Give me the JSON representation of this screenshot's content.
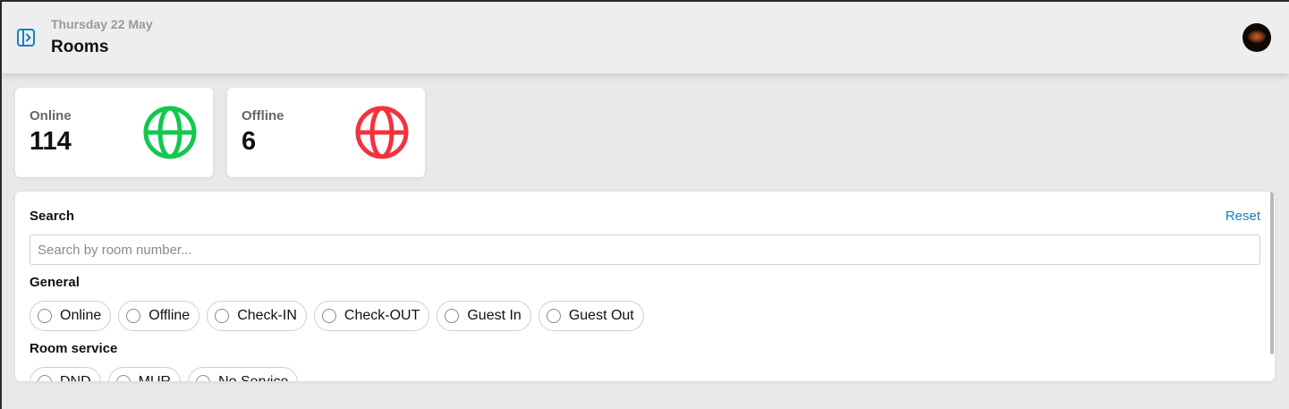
{
  "header": {
    "date": "Thursday 22 May",
    "title": "Rooms",
    "sidebar_toggle_icon": "sidebar-toggle-icon",
    "avatar_icon": "user-avatar"
  },
  "stats": {
    "online": {
      "label": "Online",
      "value": "114",
      "icon": "globe-icon",
      "color": "#12c84f"
    },
    "offline": {
      "label": "Offline",
      "value": "6",
      "icon": "globe-icon",
      "color": "#f2333d"
    }
  },
  "filters": {
    "search_title": "Search",
    "reset_label": "Reset",
    "search_placeholder": "Search by room number...",
    "search_value": "",
    "general_title": "General",
    "general_options": [
      "Online",
      "Offline",
      "Check-IN",
      "Check-OUT",
      "Guest In",
      "Guest Out"
    ],
    "room_service_title": "Room service",
    "room_service_options": [
      "DND",
      "MUR",
      "No Service"
    ]
  },
  "colors": {
    "accent": "#1a7fc0",
    "online": "#12c84f",
    "offline": "#f2333d",
    "background": "#e9e9e9"
  }
}
